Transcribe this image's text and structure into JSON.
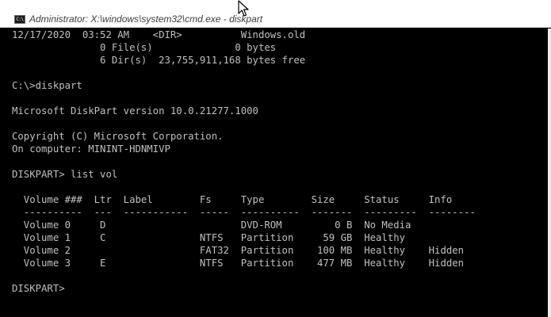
{
  "window": {
    "title": "Administrator: X:\\windows\\system32\\cmd.exe - diskpart",
    "icon_text": "C:\\",
    "icon_name": "cmd-console-icon"
  },
  "colors": {
    "console_background": "#000000",
    "console_text": "#c0c0c0",
    "titlebar_background": "#ffffff"
  },
  "console": {
    "lines": [
      "12/17/2020  03:52 AM    <DIR>          Windows.old",
      "               0 File(s)              0 bytes",
      "               6 Dir(s)  23,755,911,168 bytes free",
      "",
      "C:\\>diskpart",
      "",
      "Microsoft DiskPart version 10.0.21277.1000",
      "",
      "Copyright (C) Microsoft Corporation.",
      "On computer: MININT-HDNMIVP",
      "",
      "DISKPART> list vol",
      "",
      "  Volume ###  Ltr  Label        Fs     Type        Size     Status     Info",
      "  ----------  ---  -----------  -----  ----------  -------  ---------  --------",
      "  Volume 0     D                       DVD-ROM         0 B  No Media",
      "  Volume 1     C                NTFS   Partition     59 GB  Healthy",
      "  Volume 2                      FAT32  Partition    100 MB  Healthy    Hidden",
      "  Volume 3     E                NTFS   Partition    477 MB  Healthy    Hidden",
      "",
      "DISKPART> "
    ]
  }
}
